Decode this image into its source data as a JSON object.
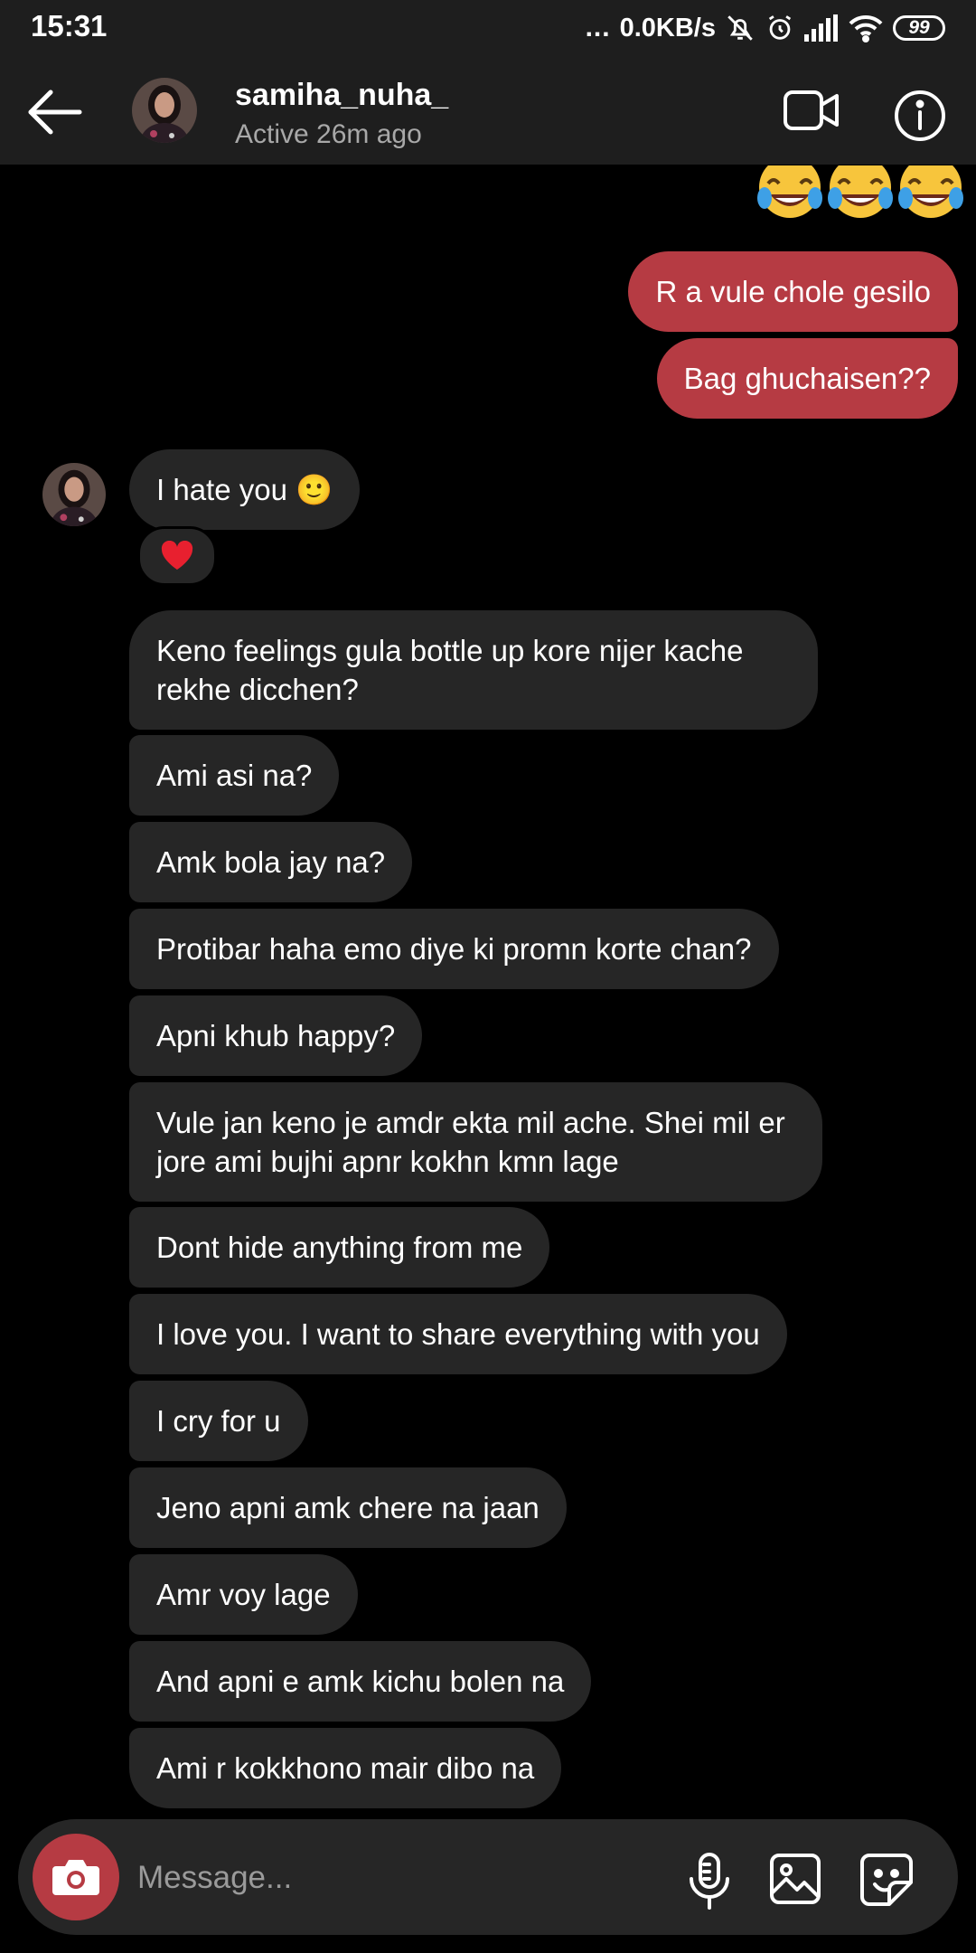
{
  "status_bar": {
    "time": "15:31",
    "dots": "...",
    "network_speed": "0.0KB/s",
    "battery": "99"
  },
  "header": {
    "username": "samiha_nuha_",
    "active_status": "Active 26m ago"
  },
  "messages": {
    "sent": [
      "R a vule chole gesilo",
      "Bag ghuchaisen??"
    ],
    "received": [
      "I hate you 🙂",
      "Keno feelings gula bottle up kore nijer kache rekhe dicchen?",
      "Ami asi na?",
      "Amk bola jay na?",
      "Protibar haha emo diye ki promn korte chan?",
      "Apni khub happy?",
      "Vule jan keno je amdr ekta mil ache. Shei mil er jore ami bujhi apnr kokhn kmn lage",
      "Dont hide anything from me",
      "I love you. I want to share everything with you",
      "I cry for u",
      "Jeno apni amk chere na jaan",
      "Amr voy lage",
      "And apni e amk kichu bolen na",
      "Ami r kokkhono mair dibo na"
    ],
    "reaction": "❤️"
  },
  "composer": {
    "placeholder": "Message..."
  },
  "colors": {
    "sent_bubble": "#b63b43",
    "received_bubble": "#262626",
    "background": "#000000",
    "bar": "#1e1e1e"
  },
  "icons": [
    "back-arrow-icon",
    "video-call-icon",
    "info-icon",
    "laughing-emoji-icon",
    "heart-icon",
    "camera-icon",
    "microphone-icon",
    "gallery-icon",
    "sticker-icon"
  ]
}
